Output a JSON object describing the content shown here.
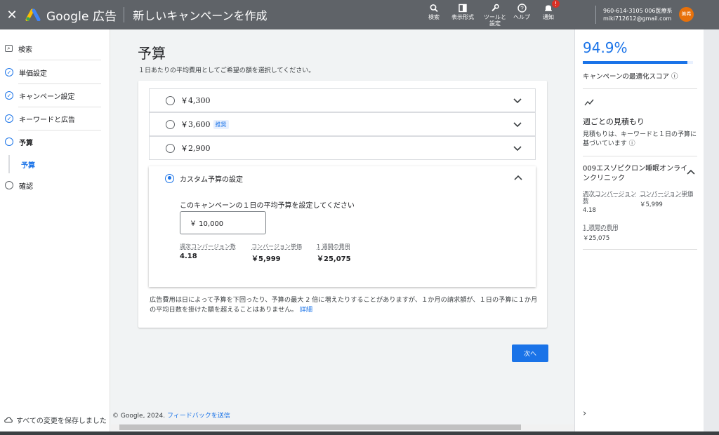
{
  "topbar": {
    "brand": "Google 広告",
    "title": "新しいキャンペーンを作成",
    "actions": [
      {
        "icon": "search-icon",
        "label": "検索"
      },
      {
        "icon": "display-icon",
        "label": "表示形式"
      },
      {
        "icon": "wrench-icon",
        "label": "ツールと\n設定"
      },
      {
        "icon": "help-icon",
        "label": "ヘルプ"
      },
      {
        "icon": "bell-icon",
        "label": "通知",
        "badge": "!"
      }
    ],
    "account_line1": "960-614-3105 006医療系",
    "account_line2": "miki712612@gmail.com",
    "avatar": "美希"
  },
  "nav": {
    "items": [
      {
        "label": "検索",
        "state": "search"
      },
      {
        "label": "単価設定",
        "state": "done"
      },
      {
        "label": "キャンペーン設定",
        "state": "done"
      },
      {
        "label": "キーワードと広告",
        "state": "done"
      },
      {
        "label": "予算",
        "state": "current"
      },
      {
        "label": "予算",
        "state": "sub"
      },
      {
        "label": "確認",
        "state": "todo"
      }
    ],
    "save_text": "すべての変更を保存しました"
  },
  "main": {
    "title": "予算",
    "subtitle": "１日あたりの平均費用としてご希望の額を選択してください。",
    "options": [
      {
        "amount": "￥4,300",
        "badge": ""
      },
      {
        "amount": "￥3,600",
        "badge": "推奨"
      },
      {
        "amount": "￥2,900",
        "badge": ""
      }
    ],
    "custom": {
      "label": "カスタム予算の設定",
      "question": "このキャンペーンの１日の平均予算を設定してください",
      "input_value": "￥ 10,000",
      "stats": [
        {
          "label": "週次コンバージョン数",
          "value": "4.18"
        },
        {
          "label": "コンバージョン単価",
          "value": "￥5,999"
        },
        {
          "label": "1 週間の費用",
          "value": "￥25,075"
        }
      ]
    },
    "note": "広告費用は日によって予算を下回ったり、予算の最大 2 倍に増えたりすることがありますが、１か月の請求額が、１日の予算に１か月の平均日数を掛けた額を超えることはありません。",
    "note_link": "詳細",
    "next_label": "次へ",
    "footer_text": "© Google, 2024. ",
    "footer_link": "フィードバックを送信"
  },
  "right": {
    "score": "94.9%",
    "score_fraction": 0.949,
    "score_label": "キャンペーンの最適化スコア ⓘ",
    "weekly_title": "週ごとの見積もり",
    "weekly_note": "見積もりは、キーワードと１日の予算に基づいています ⓘ",
    "product": "009エスゾピクロン睡眠オンラインクリニック",
    "stats": [
      {
        "label": "週次コンバージョン数",
        "value": "4.18"
      },
      {
        "label": "コンバージョン単価",
        "value": "￥5,999"
      },
      {
        "label": "1 週間の費用",
        "value": "￥25,075"
      }
    ]
  },
  "colors": {
    "accent": "#1a73e8",
    "topbar": "#5f6368",
    "avatar": "#e8710a"
  }
}
